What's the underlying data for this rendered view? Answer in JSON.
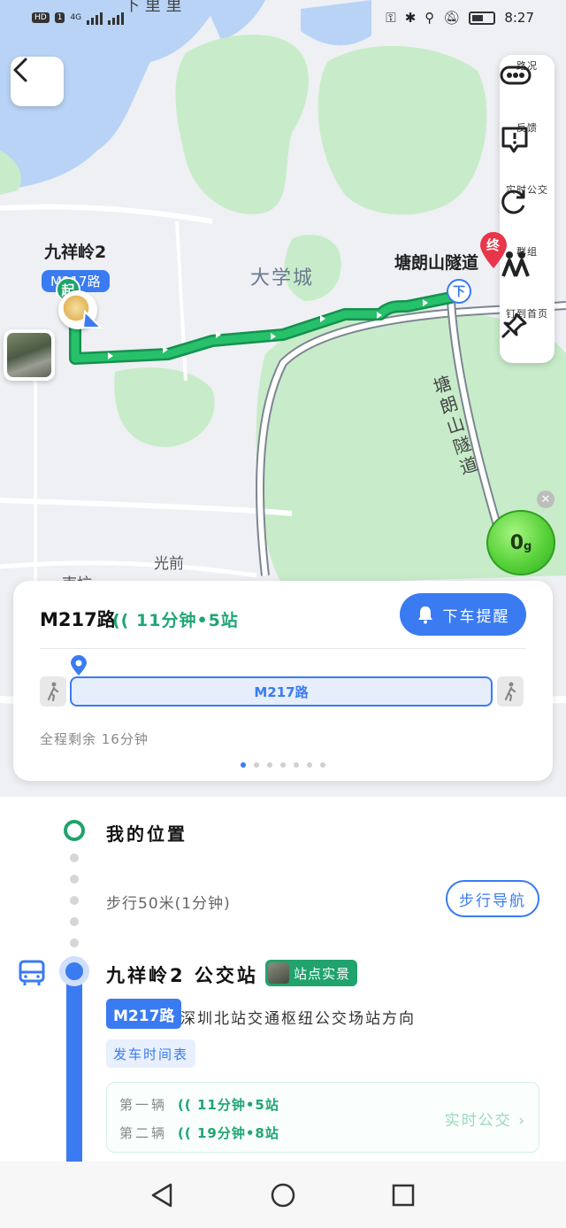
{
  "status_bar": {
    "hd": "HD",
    "sim": "1",
    "net": "4G",
    "time": "8:27"
  },
  "map": {
    "labels": {
      "top_partial": "下 里 里",
      "university": "大学城",
      "tunnel_vertical": "塘朗山隧道",
      "guangqian": "光前",
      "bottom_partial": "南坑"
    },
    "start_stop": "九祥岭2",
    "route_chip": "M217路",
    "start_badge": "起",
    "end_stop": "塘朗山隧道",
    "end_badge": "终",
    "alight_badge": "下",
    "energy_value": "0",
    "energy_unit": "g"
  },
  "toolbar": {
    "traffic": "路况",
    "feedback": "反馈",
    "realtime_bus": "实时公交",
    "group": "群组",
    "pin_home": "钉到首页"
  },
  "card": {
    "route": "M217路",
    "live": "11分钟•5站",
    "remind_button": "下车提醒",
    "bar_label": "M217路",
    "remaining": "全程剩余 16分钟",
    "page_count": 7,
    "page_active": 0
  },
  "steps": {
    "my_location": "我的位置",
    "walk": "步行50米(1分钟)",
    "walk_nav": "步行导航",
    "bus_stop": "九祥岭2 公交站",
    "live_view": "站点实景",
    "route_badge": "M217路",
    "direction": "深圳北站交通枢纽公交场站方向",
    "timetable": "发车时间表",
    "arrivals": [
      {
        "ordinal": "第一辆",
        "info": "11分钟•5站"
      },
      {
        "ordinal": "第二辆",
        "info": "19分钟•8站"
      }
    ],
    "realtime_link": "实时公交 ›"
  },
  "colors": {
    "accent": "#3a7bf2",
    "route_green": "#1fa573",
    "park_green": "#c8ecc9"
  }
}
